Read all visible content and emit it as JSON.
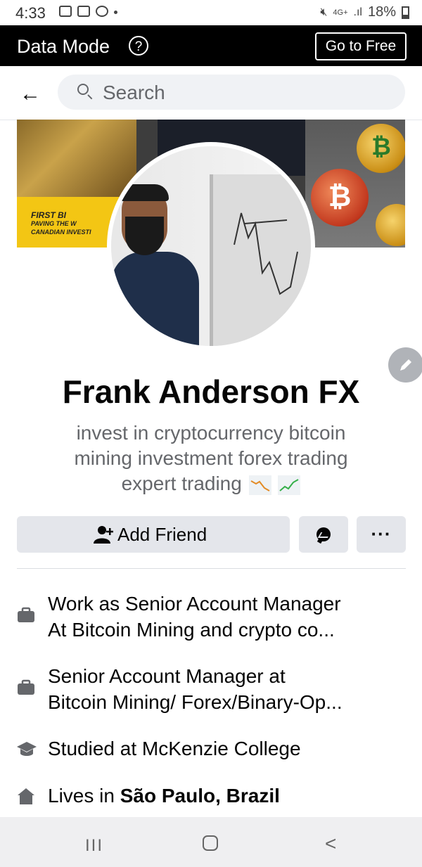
{
  "status_bar": {
    "time": "4:33",
    "network": "4G+",
    "battery": "18%"
  },
  "data_mode_bar": {
    "title": "Data Mode",
    "help_icon": "?",
    "cta": "Go to Free"
  },
  "search": {
    "placeholder": "Search"
  },
  "cover": {
    "banner_text": [
      "FIRST BI",
      "PAVING THE W",
      "CANADIAN INVESTI"
    ]
  },
  "profile": {
    "name": "Frank Anderson FX",
    "bio": "invest in cryptocurrency bitcoin mining investment forex trading expert trading"
  },
  "actions": {
    "add_friend": "Add Friend",
    "more": "···"
  },
  "details": [
    {
      "icon": "briefcase-icon",
      "line1": "Work as Senior Account Manager",
      "line2": "At Bitcoin Mining and crypto co..."
    },
    {
      "icon": "briefcase-icon",
      "line1": "Senior Account Manager at",
      "line2": "Bitcoin Mining/ Forex/Binary-Op..."
    },
    {
      "icon": "graduation-cap-icon",
      "line1": "Studied at McKenzie College"
    },
    {
      "icon": "home-icon",
      "prefix": "Lives in ",
      "place": "São Paulo, Brazil"
    }
  ],
  "nav": {
    "recents": "III"
  }
}
